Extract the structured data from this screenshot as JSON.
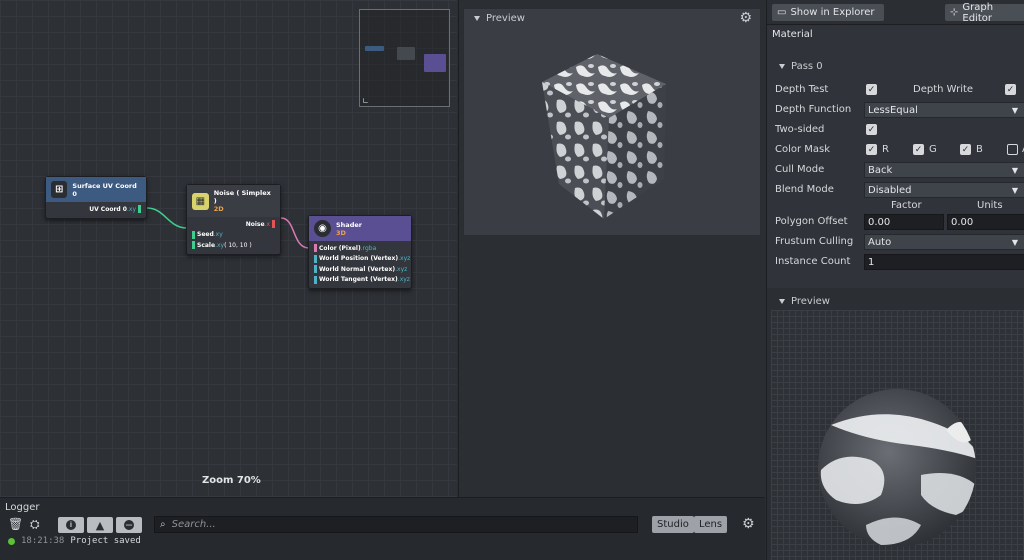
{
  "graph": {
    "zoom_label": "Zoom 70%",
    "nodes": {
      "uv": {
        "title": "Surface UV Coord 0",
        "output": "UV Coord 0",
        "output_type": ".xy"
      },
      "noise": {
        "title": "Noise ( Simplex )",
        "subtitle": "2D",
        "output": "Noise",
        "output_type": ".x",
        "inputs": [
          {
            "name": "Seed",
            "type": ".xy",
            "extra": ""
          },
          {
            "name": "Scale",
            "type": ".xy",
            "extra": " ( 10, 10 )"
          }
        ]
      },
      "shader": {
        "title": "Shader",
        "subtitle": "3D",
        "inputs": [
          {
            "name": "Color (Pixel)",
            "type": ".rgba"
          },
          {
            "name": "World Position (Vertex)",
            "type": ".xyz"
          },
          {
            "name": "World Normal (Vertex)",
            "type": ".xyz"
          },
          {
            "name": "World Tangent (Vertex)",
            "type": ".xyz"
          }
        ]
      }
    }
  },
  "viewport": {
    "title": "Preview"
  },
  "logger": {
    "title": "Logger",
    "search_placeholder": "Search...",
    "buttons": {
      "studio": "Studio",
      "lens": "Lens"
    },
    "entries": [
      {
        "time": "18:21:38",
        "message": "Project saved",
        "level_color": "#5fbf3a"
      }
    ]
  },
  "inspector": {
    "show_in_explorer": "Show in Explorer",
    "graph_editor": "Graph Editor",
    "section": "Material",
    "pass": "Pass 0",
    "depth_test": "Depth Test",
    "depth_write": "Depth Write",
    "depth_function_label": "Depth Function",
    "depth_function_value": "LessEqual",
    "two_sided": "Two-sided",
    "color_mask": "Color Mask",
    "color_mask_channels": [
      "R",
      "G",
      "B",
      "A"
    ],
    "cull_mode_label": "Cull Mode",
    "cull_mode_value": "Back",
    "blend_mode_label": "Blend Mode",
    "blend_mode_value": "Disabled",
    "factor_header": "Factor",
    "units_header": "Units",
    "polygon_offset_label": "Polygon Offset",
    "polygon_offset_factor": "0.00",
    "polygon_offset_units": "0.00",
    "frustum_culling_label": "Frustum Culling",
    "frustum_culling_value": "Auto",
    "instance_count_label": "Instance Count",
    "instance_count_value": "1",
    "preview_title": "Preview"
  },
  "colors": {
    "uv_header": "#3d5a80",
    "noise_header": "#3a3d43",
    "shader_header": "#5a4f93",
    "wire_green": "#3ecf8e",
    "wire_pink": "#d97ab5",
    "accent_orange": "#f0a24a"
  }
}
